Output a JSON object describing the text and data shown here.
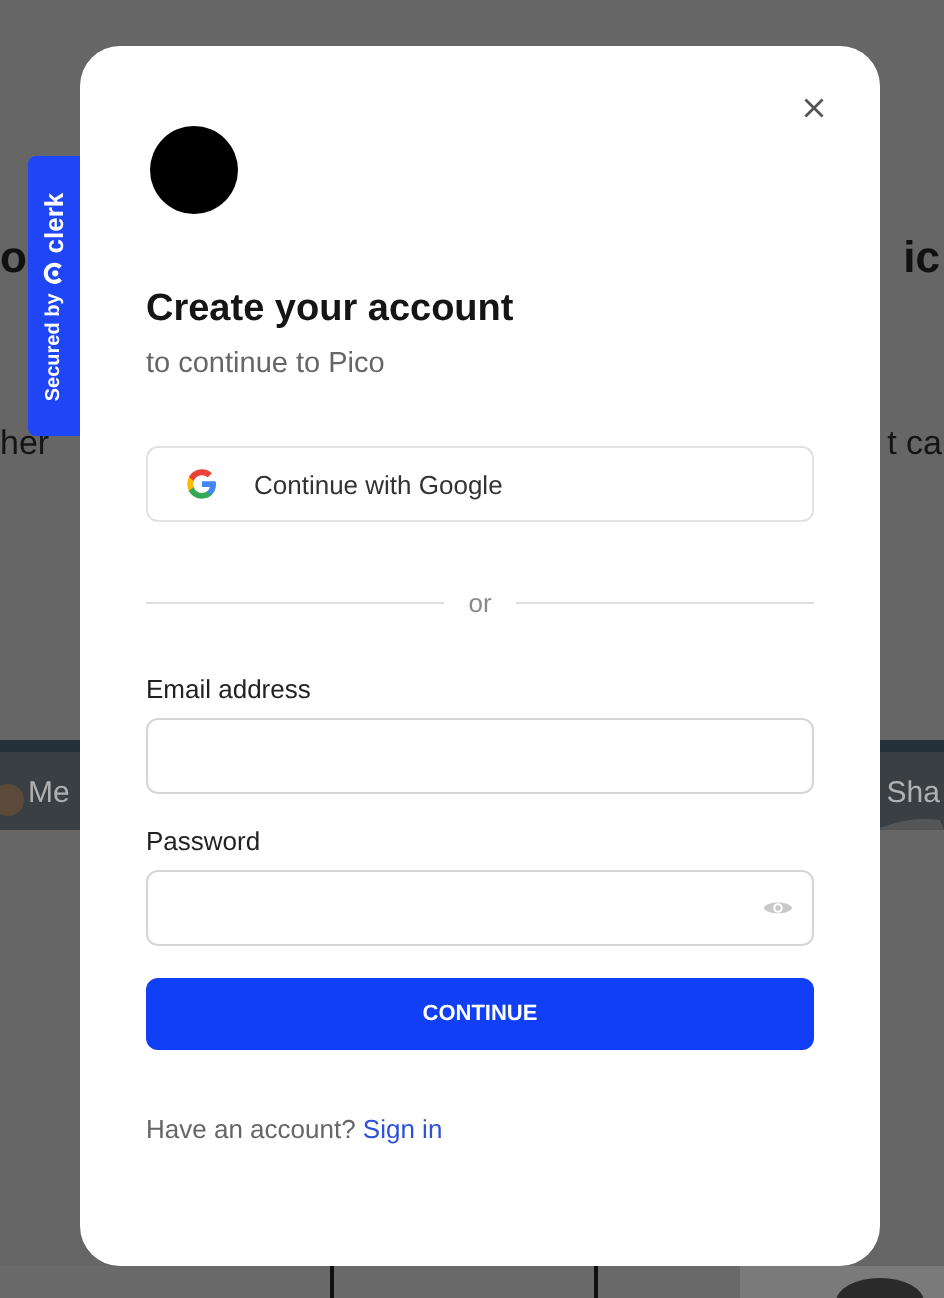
{
  "backdrop": {
    "heading_left": "o",
    "heading_right": "ic",
    "text_left": "her",
    "text_right": "t ca",
    "strip_left": "Me",
    "strip_right": "Sha"
  },
  "badge": {
    "secured": "Secured by",
    "brand": "clerk"
  },
  "modal": {
    "title": "Create your account",
    "subtitle": "to continue to Pico",
    "social_button": "Continue with Google",
    "divider": "or",
    "fields": [
      {
        "kind": "email",
        "label": "Email address"
      },
      {
        "kind": "password",
        "label": "Password"
      }
    ],
    "submit": "CONTINUE",
    "footer": {
      "text": "Have an account?",
      "link": "Sign in"
    }
  }
}
